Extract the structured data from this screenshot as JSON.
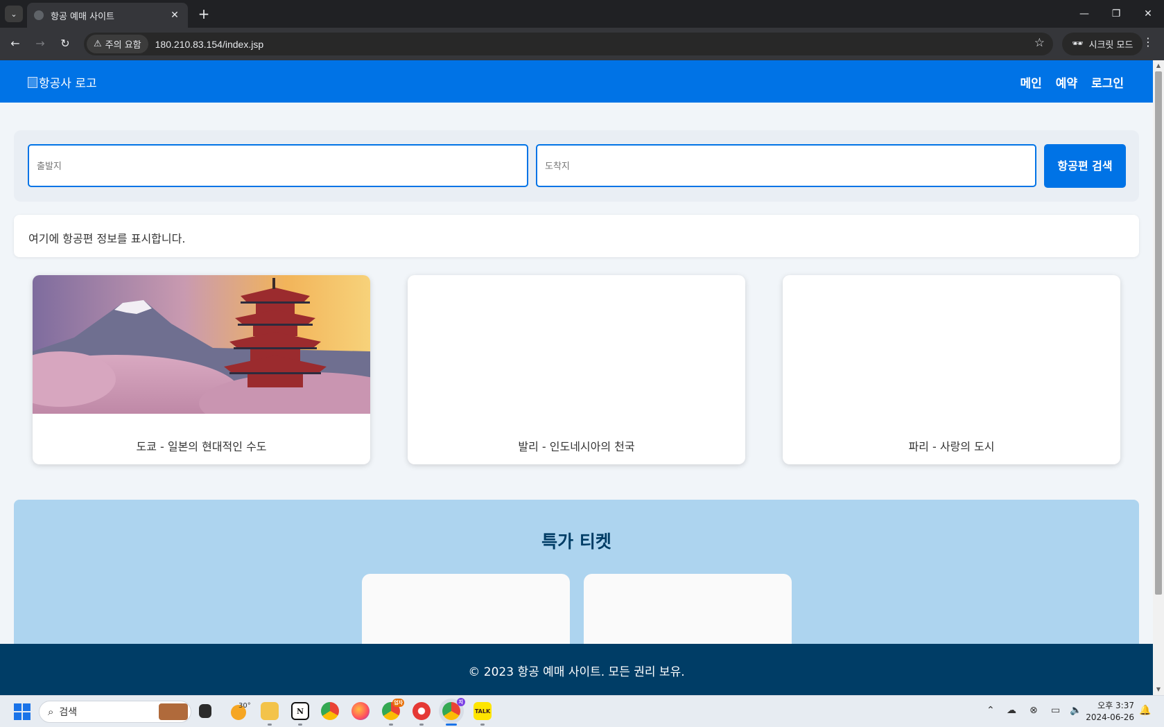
{
  "browser": {
    "tab_title": "항공 예매 사이트",
    "tab_close": "✕",
    "new_tab": "+",
    "warning_label": "주의 요함",
    "url": "180.210.83.154/index.jsp",
    "incognito_label": "시크릿 모드",
    "icons": [
      "tab-dropdown-icon",
      "back-icon",
      "forward-icon",
      "reload-icon",
      "warning-icon",
      "star-icon",
      "incognito-icon",
      "menu-icon",
      "minimize-icon",
      "maximize-icon",
      "close-icon"
    ]
  },
  "site": {
    "logo_alt": "항공사 로고",
    "nav": [
      "메인",
      "예약",
      "로그인"
    ],
    "colors": {
      "primary": "#0073e6",
      "dark": "#003d66",
      "deals_bg": "#add4ef",
      "page_bg": "#f1f5f9"
    }
  },
  "search": {
    "from_placeholder": "출발지",
    "to_placeholder": "도착지",
    "button_label": "항공편 검색"
  },
  "results_text": "여기에 항공편 정보를 표시합니다.",
  "destinations": [
    {
      "label": "도쿄 - 일본의 현대적인 수도",
      "has_image": true
    },
    {
      "label": "발리 - 인도네시아의 천국",
      "has_image": false
    },
    {
      "label": "파리 - 사랑의 도시",
      "has_image": false
    }
  ],
  "deals": {
    "title": "특가 티켓",
    "cards": 2
  },
  "footer": {
    "text": "© 2023 항공 예매 사이트. 모든 권리 보유."
  },
  "taskbar": {
    "search_label": "검색",
    "weather_temp": "30°",
    "clock_time": "오후 3:37",
    "clock_date": "2024-06-26",
    "apps": [
      "file-explorer-icon",
      "notion-icon",
      "chrome-icon",
      "firefox-icon",
      "chrome-profile-icon",
      "whale-icon",
      "chrome-active-icon",
      "kakaotalk-icon"
    ],
    "chrome_badge_1": "업자",
    "chrome_badge_2": "지",
    "kakao_label": "TALK"
  }
}
